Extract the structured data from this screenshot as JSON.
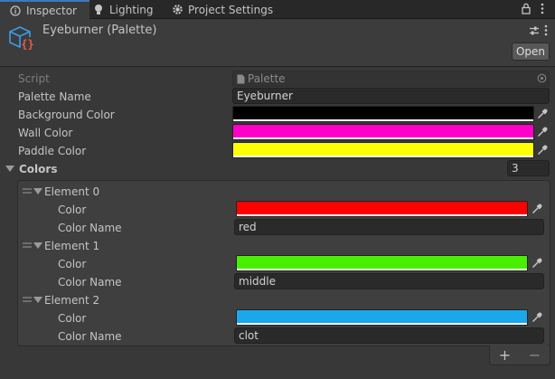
{
  "tabs": [
    {
      "label": "Inspector",
      "icon": "info-icon"
    },
    {
      "label": "Lighting",
      "icon": "lightbulb-icon"
    },
    {
      "label": "Project Settings",
      "icon": "gear-icon"
    }
  ],
  "header": {
    "title": "Eyeburner (Palette)",
    "open_label": "Open"
  },
  "script": {
    "label": "Script",
    "value": "Palette"
  },
  "palette_name": {
    "label": "Palette Name",
    "value": "Eyeburner"
  },
  "background_color": {
    "label": "Background Color",
    "color": "#000000"
  },
  "wall_color": {
    "label": "Wall Color",
    "color": "#ff00c8"
  },
  "paddle_color": {
    "label": "Paddle Color",
    "color": "#ffff00"
  },
  "colors": {
    "label": "Colors",
    "count": "3",
    "elements": [
      {
        "title": "Element 0",
        "color_label": "Color",
        "color": "#ff0000",
        "name_label": "Color Name",
        "name": "red"
      },
      {
        "title": "Element 1",
        "color_label": "Color",
        "color": "#48f000",
        "name_label": "Color Name",
        "name": "middle"
      },
      {
        "title": "Element 2",
        "color_label": "Color",
        "color": "#1aa8ea",
        "name_label": "Color Name",
        "name": "clot"
      }
    ],
    "add_label": "+",
    "remove_label": "−"
  },
  "accent_color": "#3a79bb"
}
